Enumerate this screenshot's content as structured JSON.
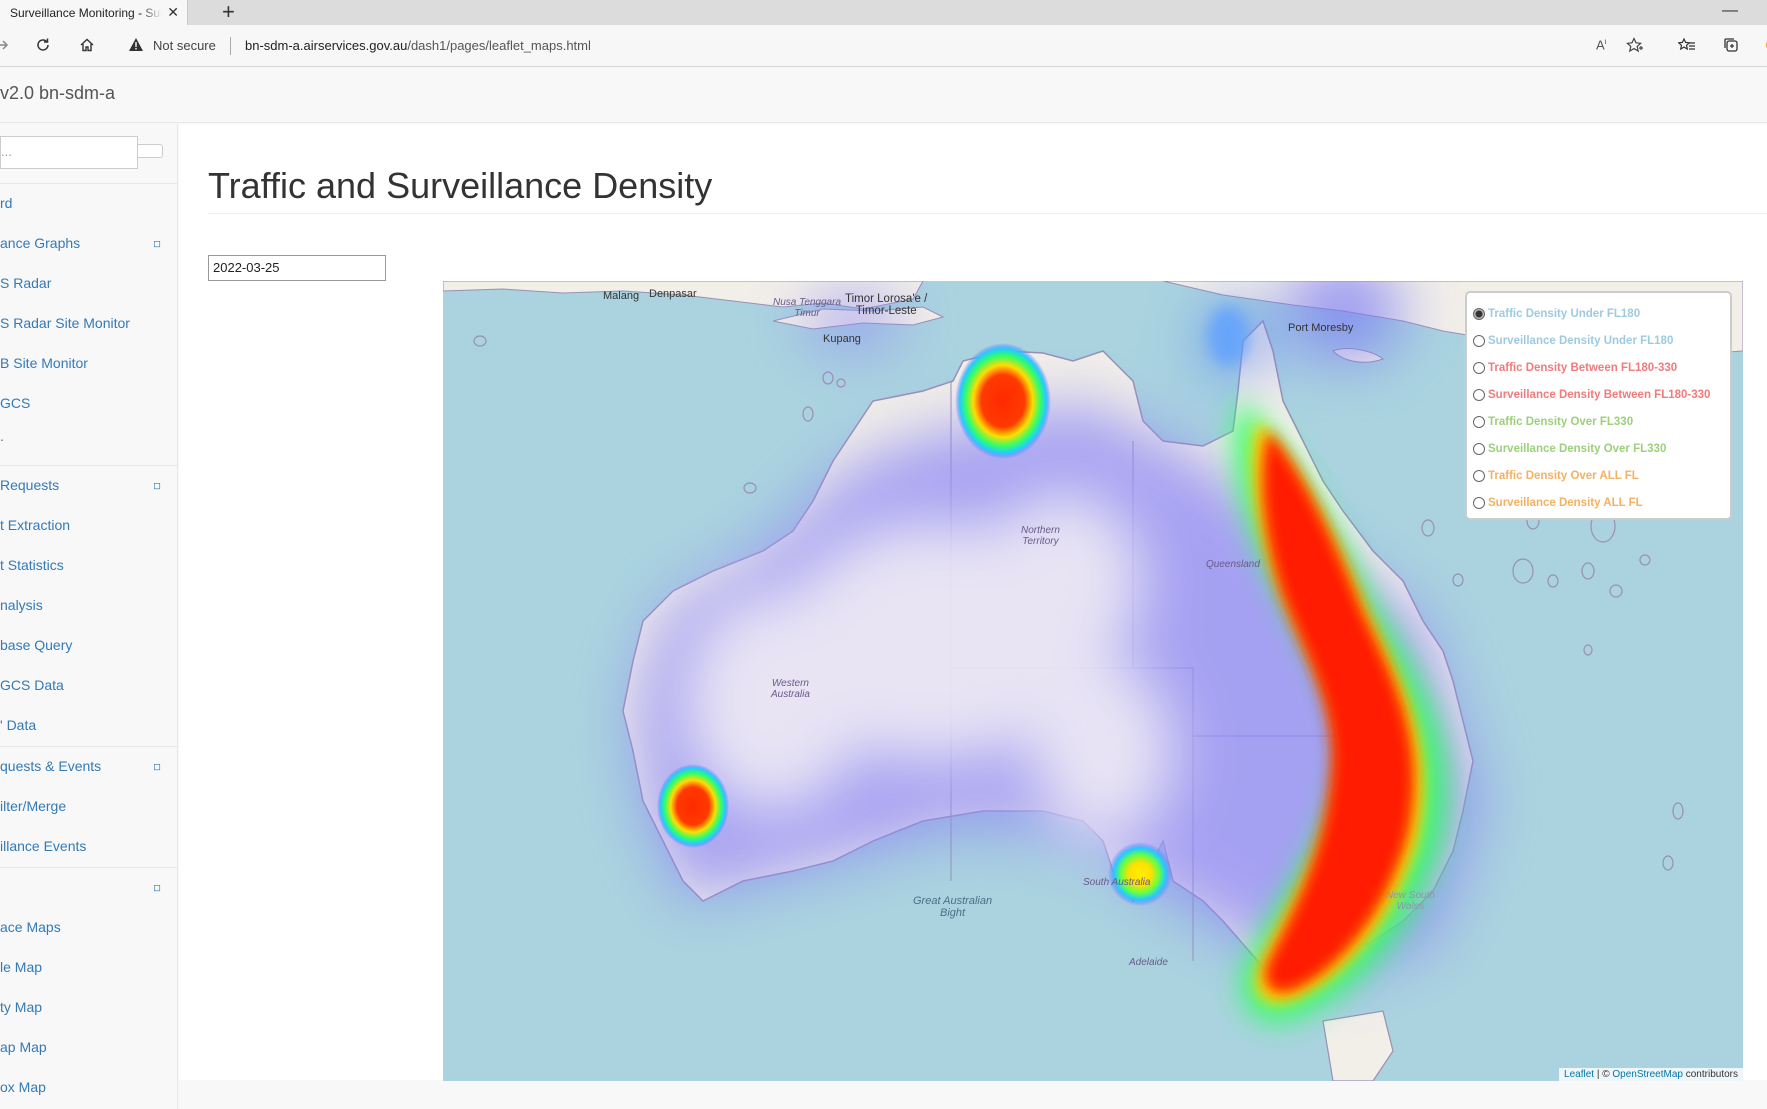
{
  "browser": {
    "tab_title": "Surveillance Monitoring - Surveillance",
    "tab_close": "✕",
    "new_tab": "+",
    "minimize": "—",
    "not_secure": "Not secure",
    "url_host": "bn-sdm-a.airservices.gov.au",
    "url_path": "/dash1/pages/leaflet_maps.html"
  },
  "app": {
    "brand": "v2.0 bn-sdm-a"
  },
  "sidebar": {
    "search_placeholder": "...",
    "items": [
      {
        "label": "rd"
      },
      {
        "label": "ance Graphs",
        "caret": "◽"
      },
      {
        "label": "S Radar"
      },
      {
        "label": "S Radar Site Monitor"
      },
      {
        "label": "B Site Monitor"
      },
      {
        "label": "GCS"
      },
      {
        "label": "."
      },
      {
        "label": "Requests",
        "caret": "◽"
      },
      {
        "label": "t Extraction"
      },
      {
        "label": "t Statistics"
      },
      {
        "label": "nalysis"
      },
      {
        "label": "base Query"
      },
      {
        "label": "GCS Data"
      },
      {
        "label": "' Data"
      },
      {
        "label": "quests & Events",
        "caret": "◽"
      },
      {
        "label": "ilter/Merge"
      },
      {
        "label": "illance Events"
      },
      {
        "label": "",
        "caret": "◽"
      },
      {
        "label": "ace Maps"
      },
      {
        "label": "le Map"
      },
      {
        "label": "ty Map"
      },
      {
        "label": "ap Map"
      },
      {
        "label": "ox Map"
      }
    ]
  },
  "main": {
    "title": "Traffic and Surveillance Density",
    "date_value": "2022-03-25"
  },
  "map": {
    "labels": {
      "malang": "Malang",
      "denpasar": "Denpasar",
      "nusa": "Nusa Tenggara\nTimur",
      "timor": "Timor Lorosa'e /\nTimor-Leste",
      "kupang": "Kupang",
      "port_moresby": "Port Moresby",
      "nt": "Northern\nTerritory",
      "qld": "Queensland",
      "wa": "Western\nAustralia",
      "sa": "South Australia",
      "gab": "Great Australian\nBight",
      "adelaide": "Adelaide",
      "nsw": "New South\nWales"
    },
    "attribution": {
      "leaflet": "Leaflet",
      "sep": " | © ",
      "osm": "OpenStreetMap",
      "rest": " contributors"
    },
    "layers": [
      {
        "label": "Traffic Density Under FL180",
        "color": "#9ecae1",
        "selected": true
      },
      {
        "label": "Surveillance Density Under FL180",
        "color": "#9ecae1",
        "selected": false
      },
      {
        "label": "Traffic Density Between FL180-330",
        "color": "#f07b7b",
        "selected": false
      },
      {
        "label": "Surveillance Density Between FL180-330",
        "color": "#f07b7b",
        "selected": false
      },
      {
        "label": "Traffic Density Over FL330",
        "color": "#9cd07a",
        "selected": false
      },
      {
        "label": "Surveillance Density Over FL330",
        "color": "#9cd07a",
        "selected": false
      },
      {
        "label": "Traffic Density Over ALL FL",
        "color": "#f5b162",
        "selected": false
      },
      {
        "label": "Surveillance Density ALL FL",
        "color": "#f5b162",
        "selected": false
      }
    ]
  }
}
